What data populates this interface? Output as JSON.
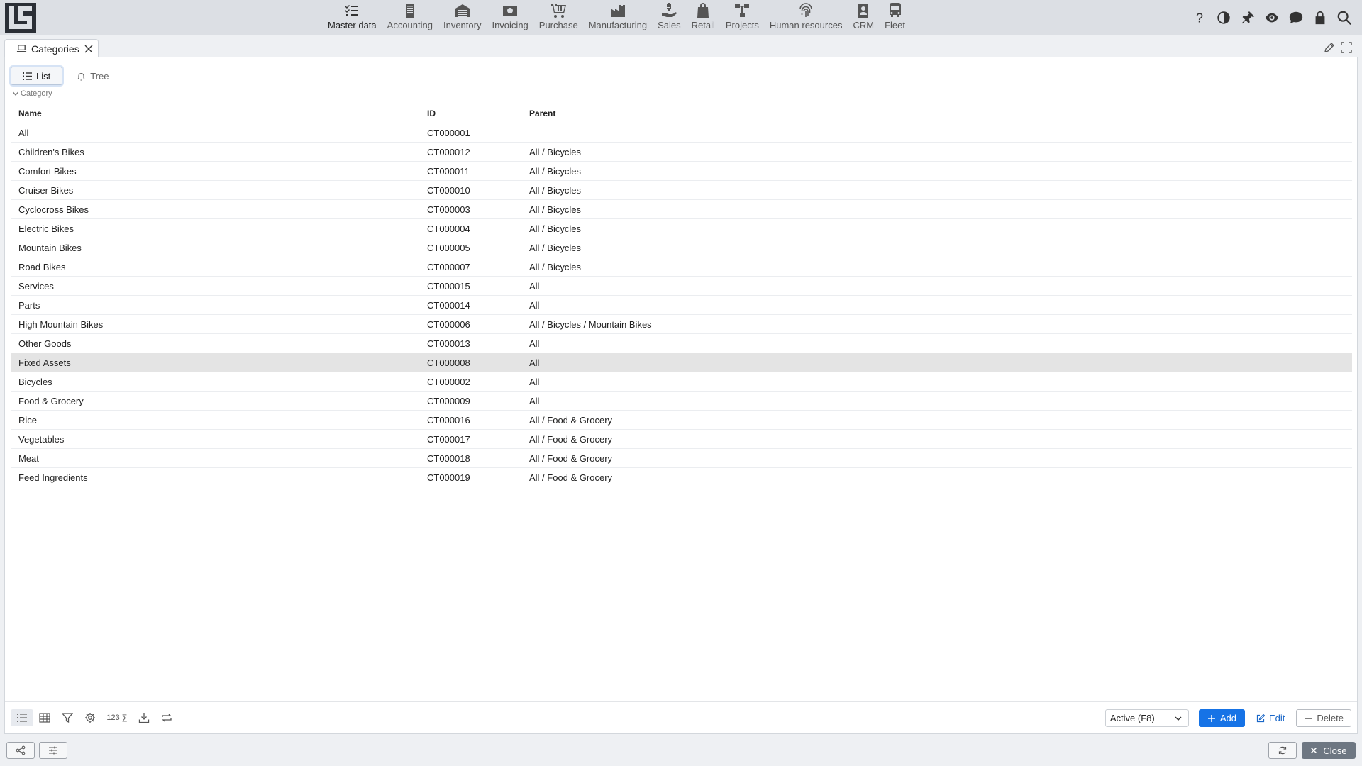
{
  "nav": {
    "modules": [
      {
        "label": "Master data",
        "icon": "checklist-icon",
        "active": true
      },
      {
        "label": "Accounting",
        "icon": "ledger-icon"
      },
      {
        "label": "Inventory",
        "icon": "warehouse-icon"
      },
      {
        "label": "Invoicing",
        "icon": "banknote-icon"
      },
      {
        "label": "Purchase",
        "icon": "cart-icon"
      },
      {
        "label": "Manufacturing",
        "icon": "factory-icon"
      },
      {
        "label": "Sales",
        "icon": "hand-coin-icon"
      },
      {
        "label": "Retail",
        "icon": "shopping-bag-icon"
      },
      {
        "label": "Projects",
        "icon": "hierarchy-icon"
      },
      {
        "label": "Human resources",
        "icon": "fingerprint-icon"
      },
      {
        "label": "CRM",
        "icon": "contact-card-icon"
      },
      {
        "label": "Fleet",
        "icon": "bus-icon"
      }
    ],
    "tools": [
      "help-icon",
      "contrast-icon",
      "pin-icon",
      "eye-icon",
      "chat-icon",
      "lock-icon",
      "search-icon"
    ]
  },
  "tab": {
    "title": "Categories"
  },
  "view_tabs": {
    "list": "List",
    "tree": "Tree"
  },
  "group": {
    "label": "Category"
  },
  "grid": {
    "headers": {
      "name": "Name",
      "id": "ID",
      "parent": "Parent"
    },
    "rows": [
      {
        "name": "All",
        "id": "CT000001",
        "parent": ""
      },
      {
        "name": "Children's Bikes",
        "id": "CT000012",
        "parent": "All / Bicycles"
      },
      {
        "name": "Comfort Bikes",
        "id": "CT000011",
        "parent": "All / Bicycles"
      },
      {
        "name": "Cruiser Bikes",
        "id": "CT000010",
        "parent": "All / Bicycles"
      },
      {
        "name": "Cyclocross Bikes",
        "id": "CT000003",
        "parent": "All / Bicycles"
      },
      {
        "name": "Electric Bikes",
        "id": "CT000004",
        "parent": "All / Bicycles"
      },
      {
        "name": "Mountain Bikes",
        "id": "CT000005",
        "parent": "All / Bicycles"
      },
      {
        "name": "Road Bikes",
        "id": "CT000007",
        "parent": "All / Bicycles"
      },
      {
        "name": "Services",
        "id": "CT000015",
        "parent": "All"
      },
      {
        "name": "Parts",
        "id": "CT000014",
        "parent": "All"
      },
      {
        "name": "High Mountain Bikes",
        "id": "CT000006",
        "parent": "All / Bicycles / Mountain Bikes"
      },
      {
        "name": "Other Goods",
        "id": "CT000013",
        "parent": "All"
      },
      {
        "name": "Fixed Assets",
        "id": "CT000008",
        "parent": "All",
        "selected": true
      },
      {
        "name": "Bicycles",
        "id": "CT000002",
        "parent": "All"
      },
      {
        "name": "Food & Grocery",
        "id": "CT000009",
        "parent": "All"
      },
      {
        "name": "Rice",
        "id": "CT000016",
        "parent": "All / Food & Grocery"
      },
      {
        "name": "Vegetables",
        "id": "CT000017",
        "parent": "All / Food & Grocery"
      },
      {
        "name": "Meat",
        "id": "CT000018",
        "parent": "All / Food & Grocery"
      },
      {
        "name": "Feed Ingredients",
        "id": "CT000019",
        "parent": "All / Food & Grocery"
      }
    ]
  },
  "footer": {
    "sum_label": "123 ∑",
    "status_value": "Active (F8)",
    "add_label": "Add",
    "edit_label": "Edit",
    "delete_label": "Delete"
  },
  "bottom": {
    "close_label": "Close"
  },
  "colors": {
    "accent": "#1673e6",
    "selected_row": "#e4e4e4",
    "topbar": "#dcdfe4"
  }
}
